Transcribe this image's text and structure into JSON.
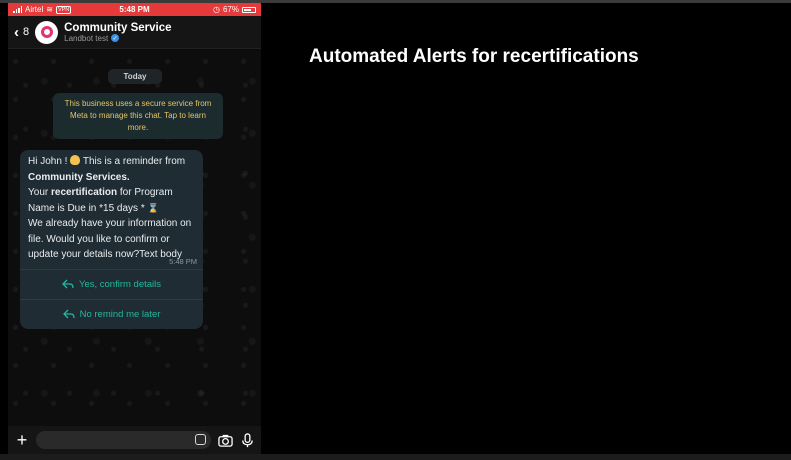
{
  "status_bar": {
    "carrier": "Airtel",
    "vpn": "VPN",
    "time": "5:48 PM",
    "battery": "67%"
  },
  "chat_header": {
    "back_count": "8",
    "title": "Community Service",
    "subtitle": "Landbot test",
    "verified_icon": "verified-badge-icon"
  },
  "chat": {
    "date_label": "Today",
    "system_notice": "This business uses a secure service from Meta to manage this chat. Tap to learn more.",
    "message": {
      "greeting": "Hi John ! ",
      "reminder_intro": " This is a reminder from ",
      "sender_bold": "Community Services.",
      "your": "Your ",
      "recert_bold": "recertification",
      "for_program": " for Program Name is Due in *15 days * ",
      "rest": "We already have your information on file. Would you like to confirm or update your details now?Text body",
      "time": "5:48 PM"
    },
    "quick_replies": [
      "Yes, confirm details",
      "No remind me later"
    ]
  },
  "input_bar": {
    "icons": [
      "plus-icon",
      "sticker-icon",
      "camera-icon",
      "microphone-icon"
    ]
  },
  "slide": {
    "heading": "Automated Alerts for recertifications"
  },
  "colors": {
    "status_bar": "#e5393a",
    "accent": "#21b7a0",
    "bubble": "#1f2c33"
  }
}
